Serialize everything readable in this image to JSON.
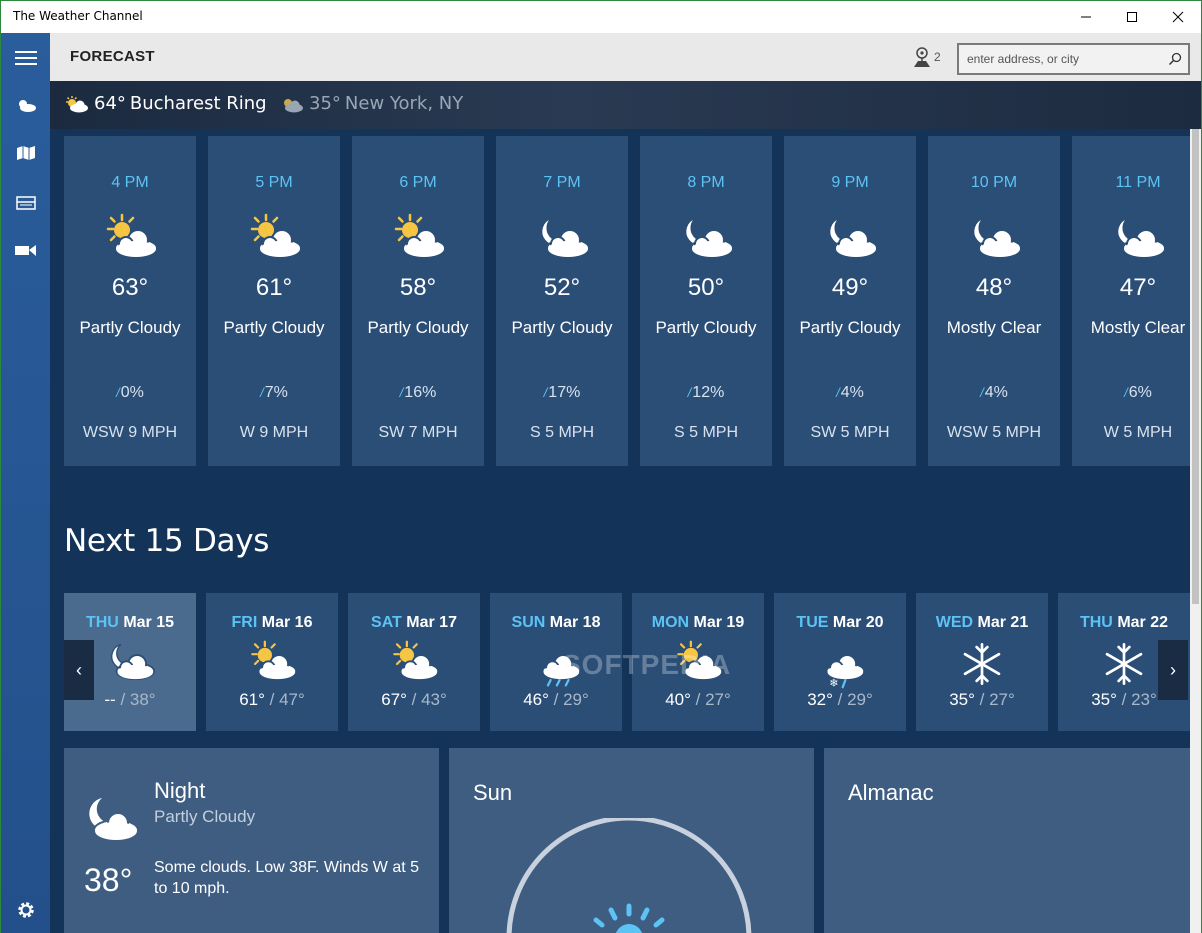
{
  "window": {
    "title": "The Weather Channel"
  },
  "header": {
    "page_title": "FORECAST",
    "location_count": "2",
    "search_placeholder": "enter address, or city"
  },
  "locations": [
    {
      "temp": "64°",
      "name": "Bucharest Ring",
      "icon": "partly-sunny-icon",
      "active": true
    },
    {
      "temp": "35°",
      "name": "New York, NY",
      "icon": "partly-cloudy-icon",
      "active": false
    }
  ],
  "hourly": [
    {
      "time": "4 PM",
      "icon": "partly-cloudy-day-icon",
      "temp": "63°",
      "condition": "Partly Cloudy",
      "precip": "0%",
      "wind": "WSW 9 MPH"
    },
    {
      "time": "5 PM",
      "icon": "partly-cloudy-day-icon",
      "temp": "61°",
      "condition": "Partly Cloudy",
      "precip": "7%",
      "wind": "W 9 MPH"
    },
    {
      "time": "6 PM",
      "icon": "partly-cloudy-day-icon",
      "temp": "58°",
      "condition": "Partly Cloudy",
      "precip": "16%",
      "wind": "SW 7 MPH"
    },
    {
      "time": "7 PM",
      "icon": "partly-cloudy-night-icon",
      "temp": "52°",
      "condition": "Partly Cloudy",
      "precip": "17%",
      "wind": "S 5 MPH"
    },
    {
      "time": "8 PM",
      "icon": "partly-cloudy-night-icon",
      "temp": "50°",
      "condition": "Partly Cloudy",
      "precip": "12%",
      "wind": "S 5 MPH"
    },
    {
      "time": "9 PM",
      "icon": "partly-cloudy-night-icon",
      "temp": "49°",
      "condition": "Partly Cloudy",
      "precip": "4%",
      "wind": "SW 5 MPH"
    },
    {
      "time": "10 PM",
      "icon": "mostly-clear-night-icon",
      "temp": "48°",
      "condition": "Mostly Clear",
      "precip": "4%",
      "wind": "WSW 5 MPH"
    },
    {
      "time": "11 PM",
      "icon": "mostly-clear-night-icon",
      "temp": "47°",
      "condition": "Mostly Clear",
      "precip": "6%",
      "wind": "W 5 MPH"
    }
  ],
  "daily_section": {
    "title": "Next 15 Days"
  },
  "daily": [
    {
      "dow": "THU",
      "date": "Mar 15",
      "icon": "partly-cloudy-night-icon",
      "hi": "--",
      "lo": "38°",
      "selected": true
    },
    {
      "dow": "FRI",
      "date": "Mar 16",
      "icon": "partly-cloudy-day-icon",
      "hi": "61°",
      "lo": "47°",
      "selected": false
    },
    {
      "dow": "SAT",
      "date": "Mar 17",
      "icon": "partly-cloudy-day-icon",
      "hi": "67°",
      "lo": "43°",
      "selected": false
    },
    {
      "dow": "SUN",
      "date": "Mar 18",
      "icon": "rain-icon",
      "hi": "46°",
      "lo": "29°",
      "selected": false
    },
    {
      "dow": "MON",
      "date": "Mar 19",
      "icon": "partly-cloudy-day-icon",
      "hi": "40°",
      "lo": "27°",
      "selected": false
    },
    {
      "dow": "TUE",
      "date": "Mar 20",
      "icon": "rain-snow-icon",
      "hi": "32°",
      "lo": "29°",
      "selected": false
    },
    {
      "dow": "WED",
      "date": "Mar 21",
      "icon": "snowflake-icon",
      "hi": "35°",
      "lo": "27°",
      "selected": false
    },
    {
      "dow": "THU",
      "date": "Mar 22",
      "icon": "snowflake-icon",
      "hi": "35°",
      "lo": "23°",
      "selected": false
    }
  ],
  "separator": " / ",
  "arrows": {
    "prev": "‹",
    "next": "›"
  },
  "night_panel": {
    "title": "Night",
    "condition": "Partly Cloudy",
    "temp": "38°",
    "description": "Some clouds. Low 38F. Winds W at 5 to 10 mph."
  },
  "sun_panel": {
    "title": "Sun"
  },
  "almanac_panel": {
    "title": "Almanac"
  },
  "watermark": "SOFTPEDIA",
  "colors": {
    "sidebar": "#2a5d9c",
    "main_bg": "#133359",
    "card_bg": "#2b4e77",
    "accent": "#5cc3f5",
    "panel_bg": "#3e5d80"
  }
}
